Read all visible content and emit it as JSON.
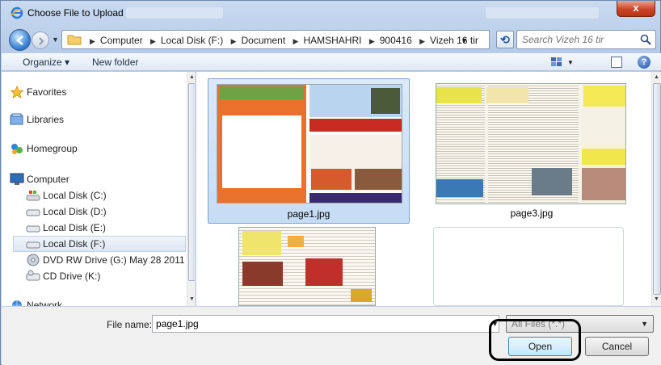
{
  "window": {
    "title": "Choose File to Upload",
    "close_label": "x"
  },
  "address": {
    "crumbs": [
      "Computer",
      "Local Disk (F:)",
      "Document",
      "HAMSHAHRI",
      "900416",
      "Vizeh 16 tir"
    ]
  },
  "search": {
    "placeholder": "Search Vizeh 16 tir"
  },
  "toolbar": {
    "organize": "Organize ▾",
    "new_folder": "New folder",
    "help": "?"
  },
  "navpane": {
    "favorites": "Favorites",
    "libraries": "Libraries",
    "homegroup": "Homegroup",
    "computer": "Computer",
    "drives": [
      {
        "label": "Local Disk (C:)"
      },
      {
        "label": "Local Disk (D:)"
      },
      {
        "label": "Local Disk (E:)"
      },
      {
        "label": "Local Disk (F:)"
      },
      {
        "label": "DVD RW Drive (G:) May 28 2011"
      },
      {
        "label": "CD Drive (K:)"
      }
    ],
    "network": "Network",
    "selected_item": "Local Disk (F:)"
  },
  "files": [
    {
      "name": "page1.jpg",
      "selected": true
    },
    {
      "name": "page3.jpg",
      "selected": false
    },
    {
      "name": "",
      "selected": false
    },
    {
      "name": "",
      "selected": false
    }
  ],
  "bottom": {
    "file_name_label": "File name:",
    "file_name_value": "page1.jpg",
    "file_type": "All Files (*.*)",
    "open_label": "Open",
    "cancel_label": "Cancel"
  },
  "colors": {
    "accent": "#3c7fb1",
    "selection": "#cce0f7",
    "highlight_ring": "#000000"
  }
}
